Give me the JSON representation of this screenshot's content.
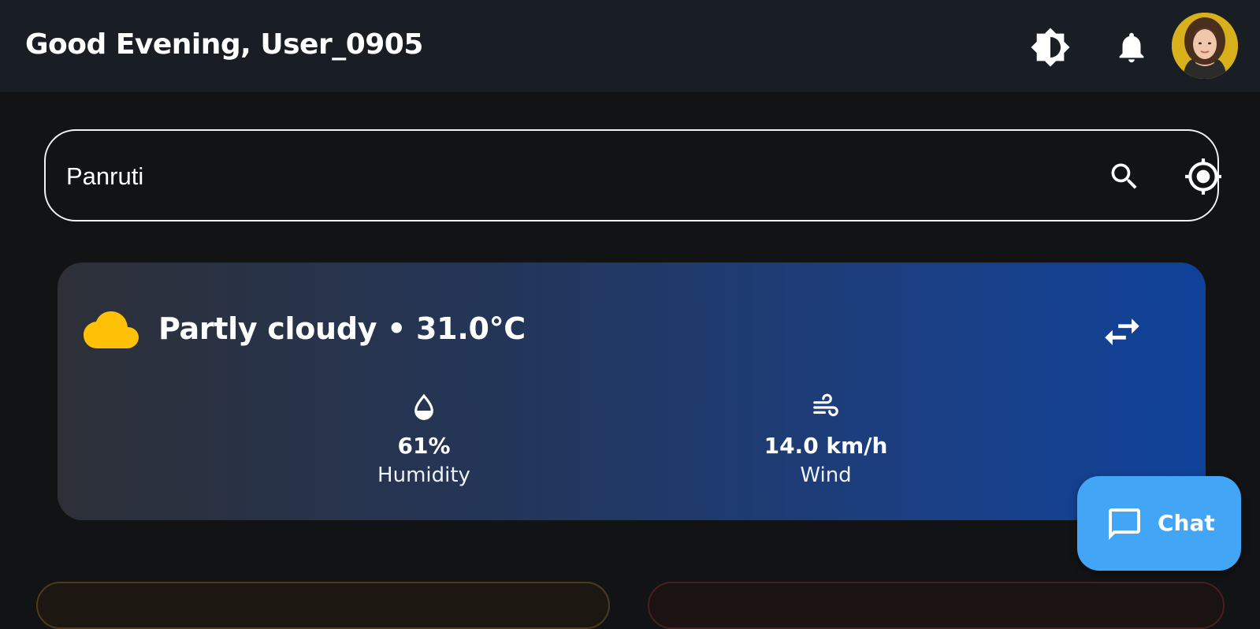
{
  "header": {
    "greeting": "Good Evening, User_0905",
    "icons": {
      "theme": "brightness-icon",
      "notifications": "bell-icon"
    }
  },
  "search": {
    "value": "Panruti",
    "icons": {
      "search": "search-icon",
      "locate": "my-location-icon"
    }
  },
  "weather": {
    "condition_line": "Partly cloudy • 31.0°C",
    "condition_icon": "cloud-icon",
    "stats": {
      "humidity": {
        "value": "61%",
        "label": "Humidity",
        "icon": "water-drop-icon"
      },
      "wind": {
        "value": "14.0 km/h",
        "label": "Wind",
        "icon": "wind-icon"
      }
    }
  },
  "chat": {
    "label": "Chat",
    "icon": "chat-bubble-icon"
  },
  "colors": {
    "background": "#121314",
    "topbar": "#191e25",
    "card_gradient_start": "#2d3037",
    "card_gradient_end": "#0f4199",
    "cloud": "#ffc107",
    "chat_button": "#42a5f5"
  }
}
